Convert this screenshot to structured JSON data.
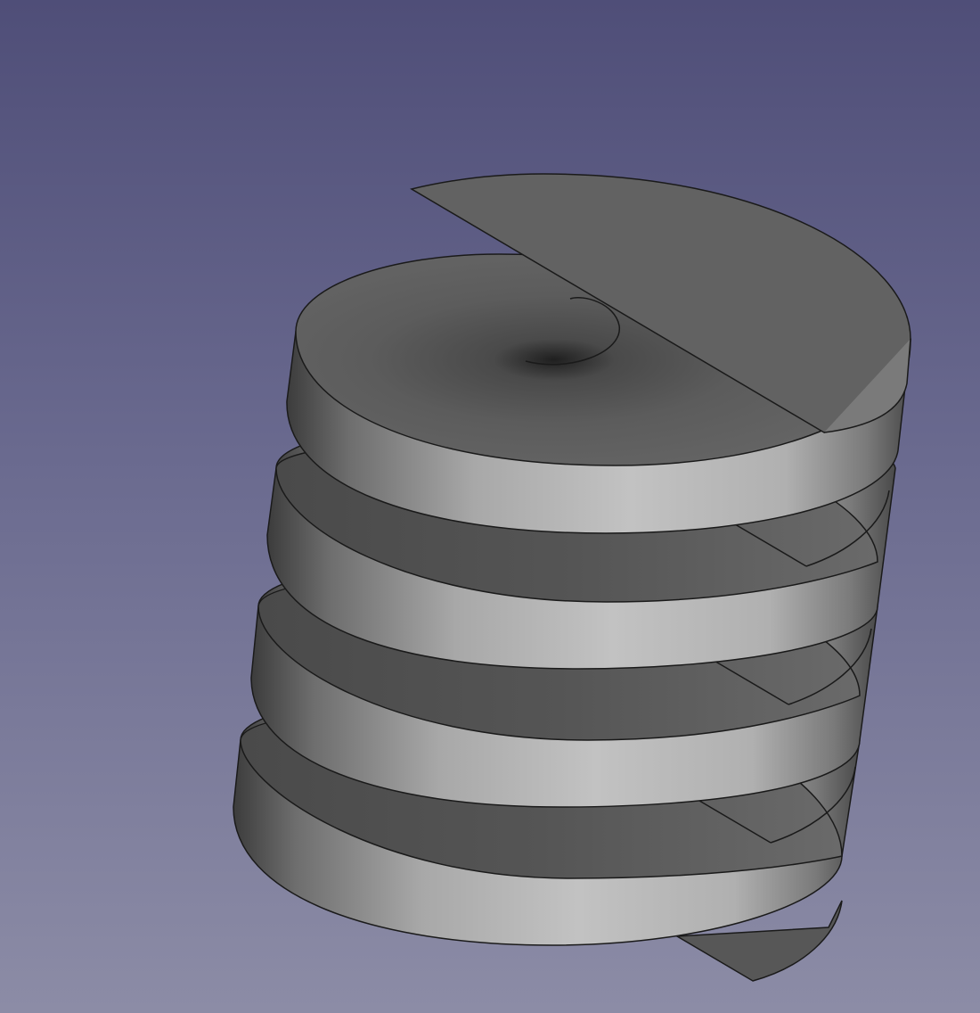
{
  "viewport": {
    "background_top": "#4f4e78",
    "background_bottom": "#8c8ca6"
  },
  "model": {
    "object": "helical-sweep-solid",
    "turns_visible": 4,
    "face_color": "#5e5e5e",
    "side_light": "#c2c2c2",
    "side_dark": "#3c3c3c",
    "edge_color": "#1a1a1a"
  }
}
